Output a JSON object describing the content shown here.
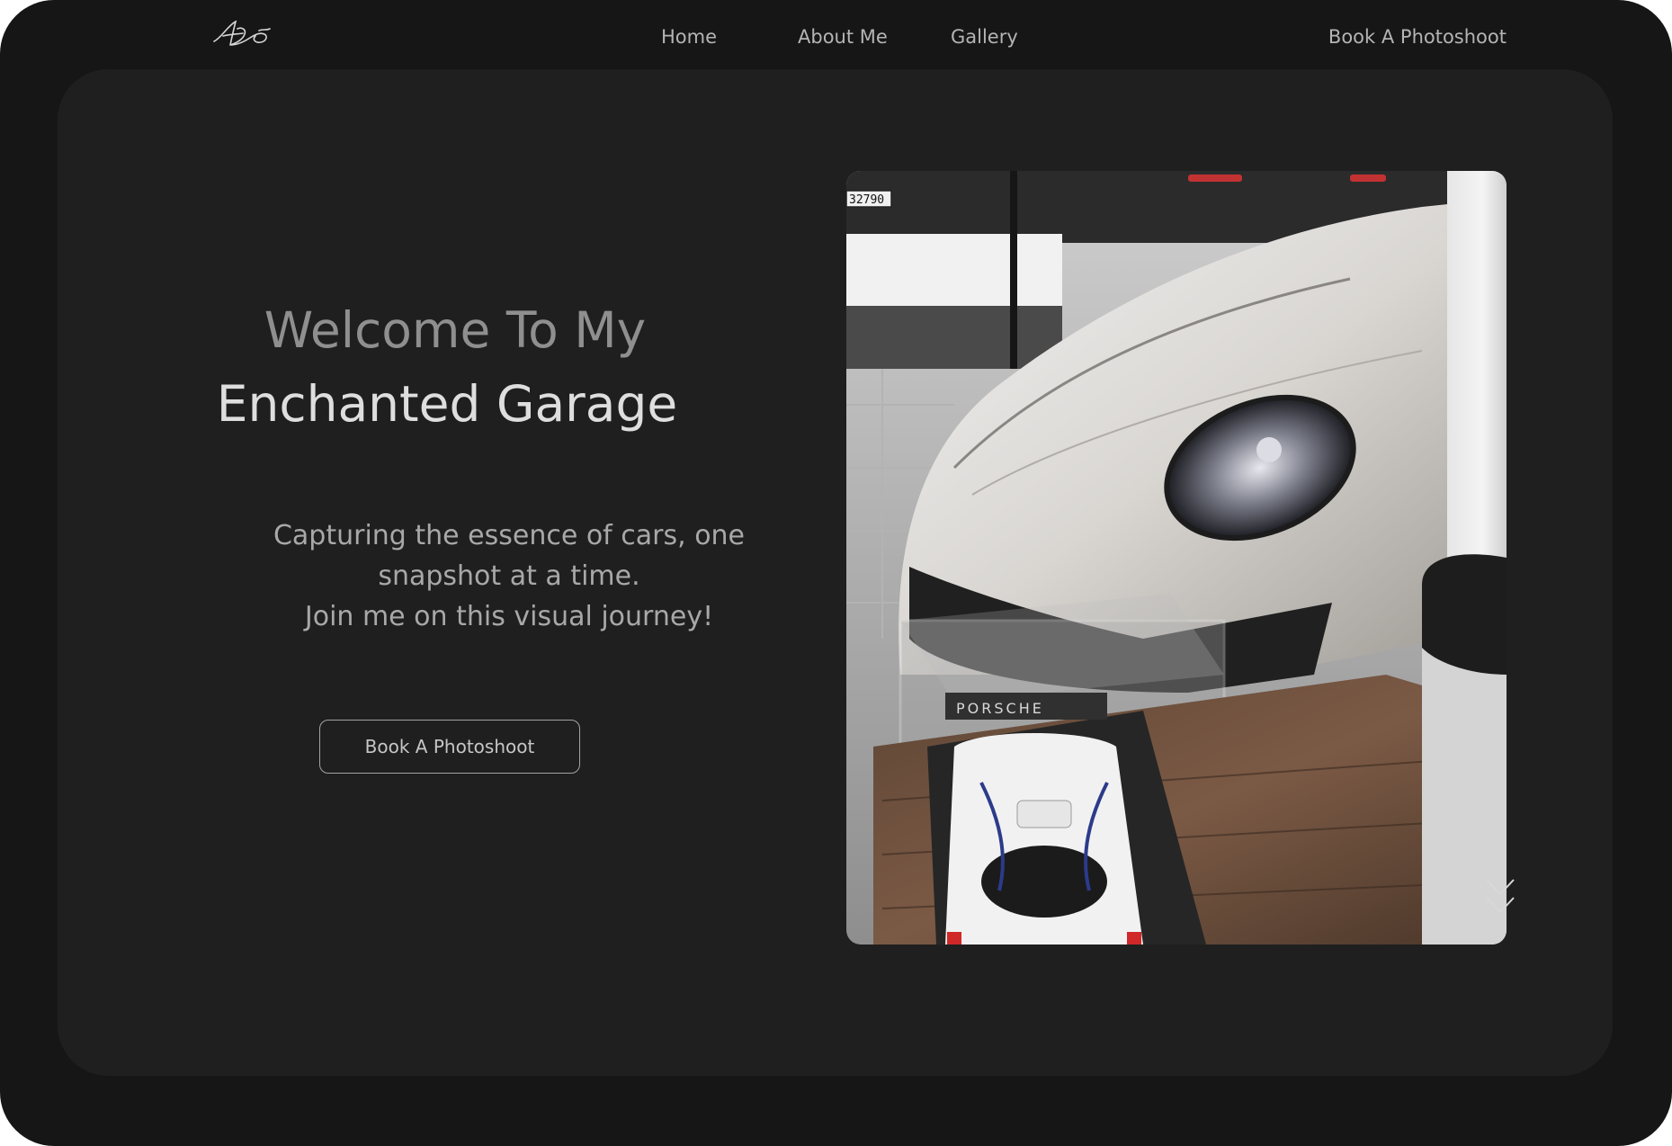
{
  "header": {
    "logo_icon": "signature-logo-icon",
    "nav": {
      "home": "Home",
      "about": "About Me",
      "gallery": "Gallery",
      "book": "Book A Photoshoot"
    }
  },
  "hero": {
    "title_line1": "Welcome To My",
    "title_line2": "Enchanted Garage",
    "tagline": [
      "Capturing the essence of cars, one",
      "snapshot at a time.",
      "Join me on this visual journey!"
    ],
    "cta_label": "Book A Photoshoot"
  },
  "photo": {
    "plate_text": "32790",
    "model_brand_text": "PORSCHE"
  },
  "scroll_indicator": {
    "icon": "double-chevron-down-icon"
  },
  "colors": {
    "page_background": "#161616",
    "panel_background": "#1f1f1f",
    "nav_text": "#b4b4b4",
    "title_muted": "#8f8f8f",
    "title_bright": "#dedede",
    "tagline_text": "#a8a8a8"
  }
}
